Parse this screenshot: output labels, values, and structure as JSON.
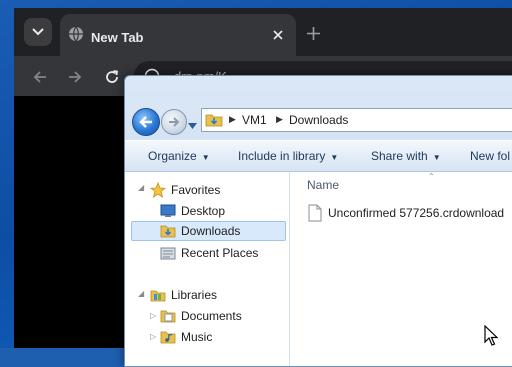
{
  "chrome": {
    "tab_title": "New Tab",
    "url_text": "drp.pm/K"
  },
  "explorer": {
    "breadcrumb": [
      "VM1",
      "Downloads"
    ],
    "commands": [
      "Organize",
      "Include in library",
      "Share with",
      "New fol"
    ],
    "nav": {
      "favorites": {
        "label": "Favorites",
        "items": [
          "Desktop",
          "Downloads",
          "Recent Places"
        ]
      },
      "libraries": {
        "label": "Libraries",
        "items": [
          "Documents",
          "Music"
        ]
      }
    },
    "column_header": "Name",
    "files": [
      {
        "name": "Unconfirmed 577256.crdownload"
      }
    ],
    "icons": [
      "star-icon",
      "desktop-icon",
      "downloads-folder-icon",
      "recent-places-icon",
      "libraries-icon",
      "documents-icon",
      "music-icon",
      "file-icon"
    ]
  },
  "colors": {
    "chrome_bg": "#202124",
    "chrome_toolbar": "#35363a",
    "explorer_frame": "#c9dbef",
    "selected_bg": "#d8e9fb",
    "desktop": "#1a5db4"
  }
}
